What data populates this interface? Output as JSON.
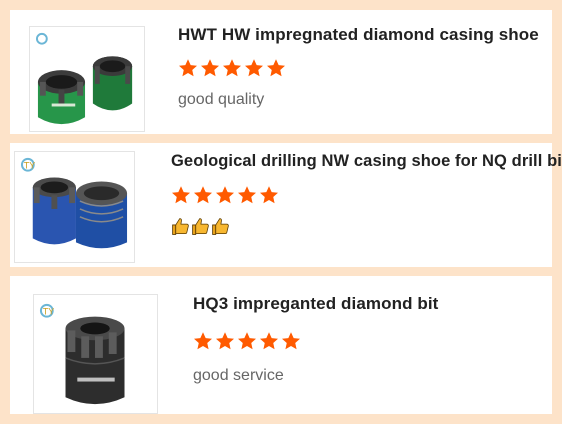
{
  "reviews": [
    {
      "title": "HWT HW impregnated diamond casing shoe",
      "rating": 5,
      "comment": "good quality",
      "image": "green-casing-shoe-photo",
      "star_color": "#ff5a00"
    },
    {
      "title": "Geological drilling NW casing shoe for NQ drill bits",
      "rating": 5,
      "comment_icons": [
        "thumbs-up-icon",
        "thumbs-up-icon",
        "thumbs-up-icon"
      ],
      "image": "blue-casing-shoe-photo",
      "star_color": "#ff5a00"
    },
    {
      "title": "HQ3 impreganted diamond bit",
      "rating": 5,
      "comment": "good service",
      "image": "black-diamond-bit-photo",
      "star_color": "#ff5a00"
    }
  ]
}
